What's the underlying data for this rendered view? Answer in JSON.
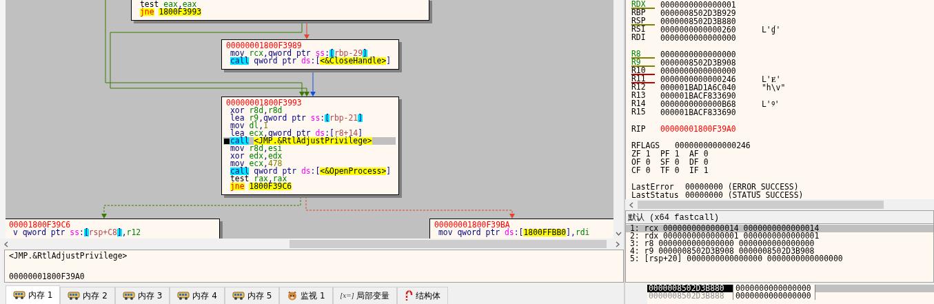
{
  "graph": {
    "nodes": [
      {
        "lines": [
          {
            "tokens": [
              {
                "kind": "mt",
                "text": "test"
              },
              {
                "kind": "reg",
                "text": " eax"
              },
              {
                "kind": "p",
                "text": ","
              },
              {
                "kind": "reg",
                "text": "eax"
              }
            ]
          },
          {
            "tokens": [
              {
                "kind": "jcc",
                "text": "jne"
              },
              {
                "kind": "sym",
                "text": "1800F3993"
              }
            ]
          }
        ]
      },
      {
        "addr": "00000001800F3989",
        "lines": [
          {
            "tokens": [
              {
                "kind": "mn",
                "text": "mov"
              },
              {
                "kind": "reg",
                "text": " rcx"
              },
              {
                "kind": "p",
                "text": ","
              },
              {
                "kind": "size",
                "text": "qword ptr "
              },
              {
                "kind": "seg",
                "text": "ss"
              },
              {
                "kind": "p",
                "text": ":"
              },
              {
                "kind": "stk",
                "text": "["
              },
              {
                "kind": "mem",
                "text": "rbp-29"
              },
              {
                "kind": "stk",
                "text": "]"
              }
            ]
          },
          {
            "tokens": [
              {
                "kind": "call",
                "text": "call"
              },
              {
                "kind": "size",
                "text": " qword ptr "
              },
              {
                "kind": "seg",
                "text": "ds"
              },
              {
                "kind": "p",
                "text": ":["
              },
              {
                "kind": "sym",
                "text": "<&CloseHandle>"
              },
              {
                "kind": "p",
                "text": "]"
              }
            ]
          }
        ]
      },
      {
        "addr": "00000001800F3993",
        "lines": [
          {
            "tokens": [
              {
                "kind": "mn",
                "text": "xor"
              },
              {
                "kind": "reg",
                "text": " r8d"
              },
              {
                "kind": "p",
                "text": ","
              },
              {
                "kind": "reg",
                "text": "r8d"
              }
            ]
          },
          {
            "tokens": [
              {
                "kind": "mn",
                "text": "lea"
              },
              {
                "kind": "reg",
                "text": " r9"
              },
              {
                "kind": "p",
                "text": ","
              },
              {
                "kind": "size",
                "text": "qword ptr "
              },
              {
                "kind": "seg",
                "text": "ss"
              },
              {
                "kind": "p",
                "text": ":"
              },
              {
                "kind": "stk",
                "text": "["
              },
              {
                "kind": "mem",
                "text": "rbp-21"
              },
              {
                "kind": "stk",
                "text": "]"
              }
            ]
          },
          {
            "tokens": [
              {
                "kind": "mn",
                "text": "mov"
              },
              {
                "kind": "reg",
                "text": " dl"
              },
              {
                "kind": "p",
                "text": ","
              },
              {
                "kind": "imm",
                "text": "1"
              }
            ]
          },
          {
            "tokens": [
              {
                "kind": "mn",
                "text": "lea"
              },
              {
                "kind": "reg",
                "text": " ecx"
              },
              {
                "kind": "p",
                "text": ","
              },
              {
                "kind": "size",
                "text": "qword ptr "
              },
              {
                "kind": "seg",
                "text": "ds"
              },
              {
                "kind": "p",
                "text": ":["
              },
              {
                "kind": "mem",
                "text": "r8+14"
              },
              {
                "kind": "p",
                "text": "]"
              }
            ]
          },
          {
            "current": true,
            "tokens": [
              {
                "kind": "call",
                "text": "call"
              },
              {
                "kind": "sym",
                "text": "<JMP.&RtlAdjustPrivilege>"
              }
            ]
          },
          {
            "tokens": [
              {
                "kind": "mn",
                "text": "mov"
              },
              {
                "kind": "reg",
                "text": " r8d"
              },
              {
                "kind": "p",
                "text": ","
              },
              {
                "kind": "reg",
                "text": "esi"
              }
            ]
          },
          {
            "tokens": [
              {
                "kind": "mn",
                "text": "xor"
              },
              {
                "kind": "reg",
                "text": " edx"
              },
              {
                "kind": "p",
                "text": ","
              },
              {
                "kind": "reg",
                "text": "edx"
              }
            ]
          },
          {
            "tokens": [
              {
                "kind": "mn",
                "text": "mov"
              },
              {
                "kind": "reg",
                "text": " ecx"
              },
              {
                "kind": "p",
                "text": ","
              },
              {
                "kind": "imm",
                "text": "478"
              }
            ]
          },
          {
            "tokens": [
              {
                "kind": "call",
                "text": "call"
              },
              {
                "kind": "size",
                "text": " qword ptr "
              },
              {
                "kind": "seg",
                "text": "ds"
              },
              {
                "kind": "p",
                "text": ":["
              },
              {
                "kind": "sym",
                "text": "<&OpenProcess>"
              },
              {
                "kind": "p",
                "text": "]"
              }
            ]
          },
          {
            "tokens": [
              {
                "kind": "mt",
                "text": "test"
              },
              {
                "kind": "reg",
                "text": " rax"
              },
              {
                "kind": "p",
                "text": ","
              },
              {
                "kind": "reg",
                "text": "rax"
              }
            ]
          },
          {
            "tokens": [
              {
                "kind": "jcc",
                "text": "jne"
              },
              {
                "kind": "sym",
                "text": "1800F39C6"
              }
            ]
          }
        ]
      },
      {
        "addr": "00001800F39C6",
        "lines": [
          {
            "tokens": [
              {
                "kind": "size",
                "text": "v qword ptr "
              },
              {
                "kind": "seg",
                "text": "ss"
              },
              {
                "kind": "p",
                "text": ":"
              },
              {
                "kind": "stk",
                "text": "["
              },
              {
                "kind": "mem",
                "text": "rsp+C8"
              },
              {
                "kind": "stk",
                "text": "]"
              },
              {
                "kind": "p",
                "text": ","
              },
              {
                "kind": "reg",
                "text": "r12"
              }
            ]
          }
        ]
      },
      {
        "addr": "00000001800F39BA",
        "lines": [
          {
            "tokens": [
              {
                "kind": "mn",
                "text": "mov"
              },
              {
                "kind": "size",
                "text": " qword ptr "
              },
              {
                "kind": "seg",
                "text": "ds"
              },
              {
                "kind": "p",
                "text": ":["
              },
              {
                "kind": "sym",
                "text": "1800FFBB0"
              },
              {
                "kind": "p",
                "text": "]"
              },
              {
                "kind": "p",
                "text": ","
              },
              {
                "kind": "reg",
                "text": "rdi"
              }
            ]
          }
        ]
      }
    ],
    "edges": [
      {
        "kind": "taken",
        "dashed": false
      },
      {
        "kind": "taken",
        "dashed": false
      },
      {
        "kind": "fallthrough",
        "dashed": false
      },
      {
        "kind": "direct",
        "dashed": false
      },
      {
        "kind": "taken",
        "dashed": true
      },
      {
        "kind": "fallthrough",
        "dashed": true
      }
    ]
  },
  "info": {
    "lines": [
      "<JMP.&RtlAdjustPrivilege>",
      "00000001800F39A0"
    ]
  },
  "tabs": [
    {
      "label": "内存 1",
      "kind": "memory",
      "selected": true
    },
    {
      "label": "内存 2",
      "kind": "memory",
      "selected": false
    },
    {
      "label": "内存 3",
      "kind": "memory",
      "selected": false
    },
    {
      "label": "内存 4",
      "kind": "memory",
      "selected": false
    },
    {
      "label": "内存 5",
      "kind": "memory",
      "selected": false
    },
    {
      "label": "监视 1",
      "kind": "watch",
      "selected": false
    },
    {
      "label": "局部变量",
      "kind": "locals",
      "icon_text": "[x=]",
      "selected": false
    },
    {
      "label": "结构体",
      "kind": "struct",
      "selected": false
    }
  ],
  "registers": {
    "groups": [
      [
        {
          "name": "RDX",
          "value": "0000000000000001",
          "changed": true,
          "color": "#808000"
        },
        {
          "name": "RBP",
          "value": "0000008502D3B929",
          "changed": false
        },
        {
          "name": "RSP",
          "value": "0000008502D3B880",
          "changed": false,
          "color": "#808000"
        },
        {
          "name": "RSI",
          "value": "0000000000000260",
          "changed": false,
          "comment": "L'ɠ'"
        },
        {
          "name": "RDI",
          "value": "0000000000000000",
          "changed": false
        }
      ],
      [
        {
          "name": "R8",
          "value": "0000000000000000",
          "changed": true,
          "color": "#808000"
        },
        {
          "name": "R9",
          "value": "0000008502D3B908",
          "changed": true,
          "color": "#808000"
        },
        {
          "name": "R10",
          "value": "0000000000000000",
          "changed": false,
          "color": "#c00000"
        },
        {
          "name": "R11",
          "value": "0000000000000246",
          "changed": false,
          "color": "#c00000",
          "comment": "L'Ɇ'"
        },
        {
          "name": "R12",
          "value": "000001BAD1A6C040",
          "changed": false,
          "comment": "\"h\\v\""
        },
        {
          "name": "R13",
          "value": "000001BACF833690",
          "changed": false
        },
        {
          "name": "R14",
          "value": "0000000000000B68",
          "changed": false,
          "comment": "L'୨'"
        },
        {
          "name": "R15",
          "value": "000001BACF833690",
          "changed": false
        }
      ]
    ],
    "rip": {
      "name": "RIP",
      "value": "00000001800F39A0",
      "changed": true
    },
    "rflags": {
      "name": "RFLAGS",
      "value": "0000000000000246"
    },
    "flags": [
      {
        "name": "ZF",
        "value": "1"
      },
      {
        "name": "PF",
        "value": "1"
      },
      {
        "name": "AF",
        "value": "0"
      },
      {
        "name": "OF",
        "value": "0"
      },
      {
        "name": "SF",
        "value": "0"
      },
      {
        "name": "DF",
        "value": "0"
      },
      {
        "name": "CF",
        "value": "0"
      },
      {
        "name": "TF",
        "value": "0"
      },
      {
        "name": "IF",
        "value": "1"
      }
    ],
    "status": [
      {
        "name": "LastError",
        "value": "00000000 (ERROR_SUCCESS)"
      },
      {
        "name": "LastStatus",
        "value": "00000000 (STATUS_SUCCESS)"
      }
    ]
  },
  "call_convention": {
    "title": "默认 (x64 fastcall)",
    "args": [
      {
        "text": "1: rcx 0000000000000014 0000000000000014",
        "selected": true
      },
      {
        "text": "2: rdx 0000000000000001 0000000000000001",
        "selected": false
      },
      {
        "text": "3: r8 0000000000000000 0000000000000000",
        "selected": false
      },
      {
        "text": "4: r9 0000008502D3B908 0000008502D3B908",
        "selected": false
      },
      {
        "text": "5: [rsp+20] 0000000000000000 0000000000000000",
        "selected": false
      }
    ]
  },
  "stack": [
    {
      "address": "0000008502D3B880",
      "value": "0000000000000000",
      "selected": true
    },
    {
      "address": "0000008502D3B888",
      "value": "0000000000000000",
      "selected": false
    }
  ]
}
